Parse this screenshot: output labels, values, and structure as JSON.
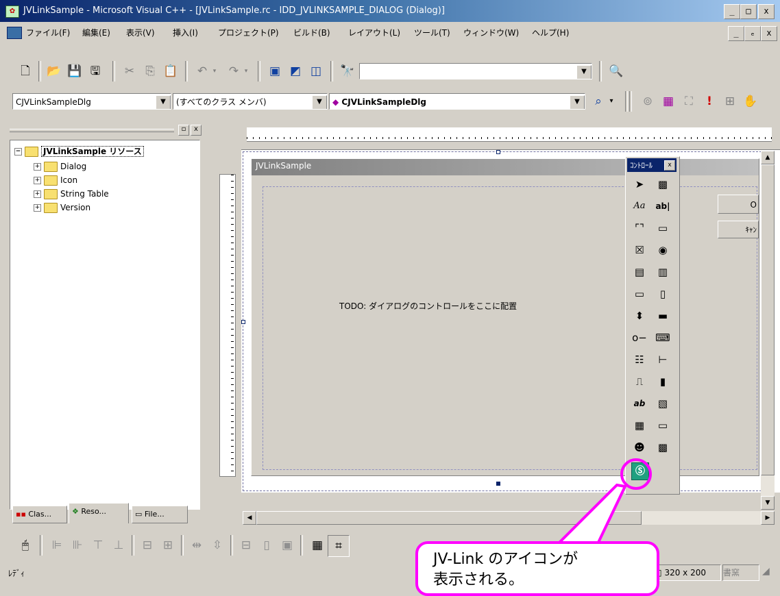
{
  "window": {
    "title": "JVLinkSample - Microsoft Visual C++ - [JVLinkSample.rc - IDD_JVLINKSAMPLE_DIALOG (Dialog)]",
    "min": "_",
    "max": "□",
    "close": "x",
    "doc_min": "_",
    "doc_restore": "ₑ",
    "doc_close": "x"
  },
  "menu": [
    "ファイル(F)",
    "編集(E)",
    "表示(V)",
    "挿入(I)",
    "プロジェクト(P)",
    "ビルド(B)",
    "レイアウト(L)",
    "ツール(T)",
    "ウィンドウ(W)",
    "ヘルプ(H)"
  ],
  "toolbar2": {
    "class_combo": "CJVLinkSampleDlg",
    "member_combo": "(すべてのクラス メンバ)",
    "function_combo": "CJVLinkSampleDlg"
  },
  "workspace": {
    "root": "JVLinkSample リソース",
    "folders": [
      "Dialog",
      "Icon",
      "String Table",
      "Version"
    ],
    "tabs": [
      "Clas...",
      "Reso...",
      "File..."
    ]
  },
  "dialog": {
    "title": "JVLinkSample",
    "todo_text": "TODO: ダイアログのコントロールをここに配置",
    "ok_label": "O",
    "cancel_label": "ｷｬﾝ"
  },
  "controls_toolbox": {
    "title": "ｺﾝﾄﾛｰﾙ",
    "close": "x",
    "icons": [
      "pointer-icon",
      "picture-icon",
      "static-text-icon",
      "edit-box-icon",
      "group-box-icon",
      "button-icon",
      "check-box-icon",
      "radio-button-icon",
      "combo-box-icon",
      "list-box-icon",
      "h-scrollbar-icon",
      "v-scrollbar-icon",
      "spin-icon",
      "progress-icon",
      "slider-icon",
      "hotkey-icon",
      "list-control-icon",
      "tree-control-icon",
      "tab-control-icon",
      "animate-icon",
      "rich-edit-icon",
      "datetime-icon",
      "month-calendar-icon",
      "ip-address-icon",
      "custom-control-icon",
      "extended-combo-icon",
      "jvlink-icon"
    ]
  },
  "callout": {
    "text_line1": "JV-Link のアイコンが",
    "text_line2": "表示される。"
  },
  "status": {
    "ready": "ﾚﾃﾞｨ",
    "size": "320 x 200",
    "mode": "書窯"
  },
  "colors": {
    "title_start": "#0a246a",
    "title_end": "#a6caf0",
    "callout_border": "#ff00ff"
  }
}
